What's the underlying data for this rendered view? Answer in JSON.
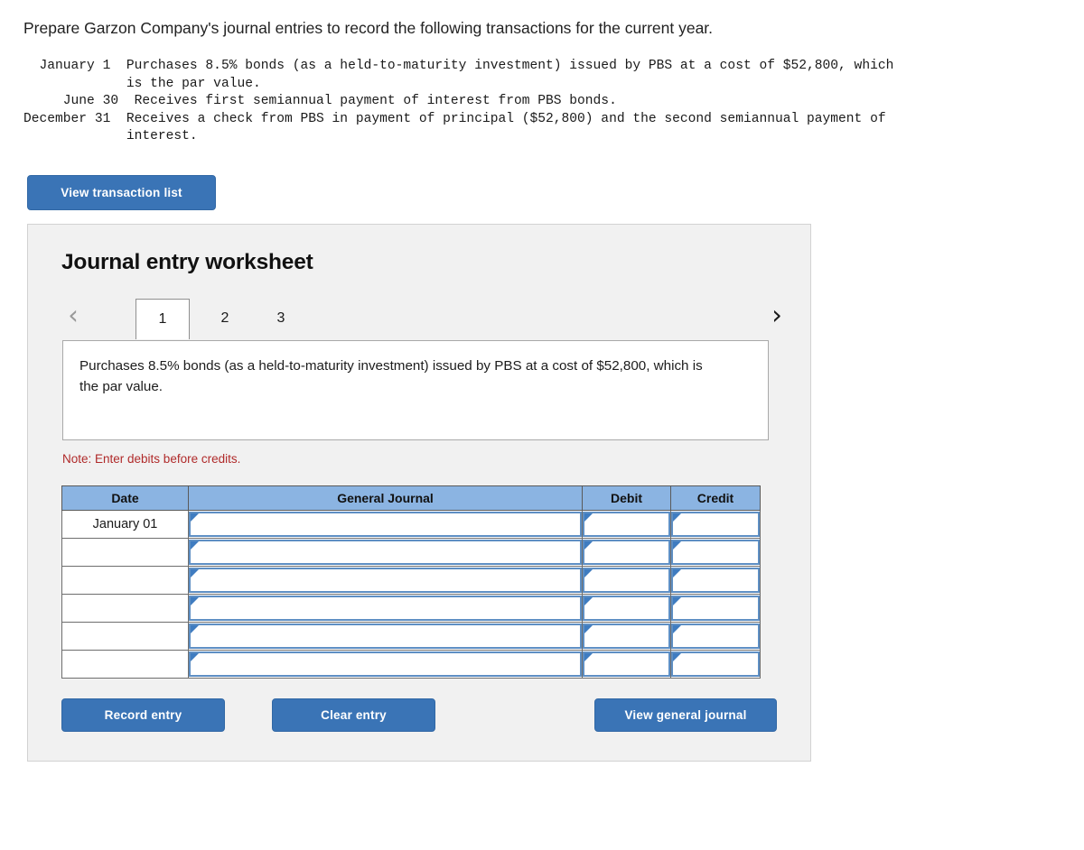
{
  "prompt": "Prepare Garzon Company's journal entries to record the following transactions for the current year.",
  "transactions_text": "  January 1  Purchases 8.5% bonds (as a held-to-maturity investment) issued by PBS at a cost of $52,800, which\n             is the par value.\n     June 30  Receives first semiannual payment of interest from PBS bonds.\nDecember 31  Receives a check from PBS in payment of principal ($52,800) and the second semiannual payment of\n             interest.",
  "buttons": {
    "view_transaction_list": "View transaction list",
    "record_entry": "Record entry",
    "clear_entry": "Clear entry",
    "view_general_journal": "View general journal"
  },
  "worksheet": {
    "title": "Journal entry worksheet",
    "prev_icon": "‹",
    "next_icon": "›",
    "tabs": [
      {
        "label": "1",
        "active": true
      },
      {
        "label": "2",
        "active": false
      },
      {
        "label": "3",
        "active": false
      }
    ],
    "description": "Purchases 8.5% bonds (as a held-to-maturity investment) issued by PBS at a cost of $52,800, which is the par value.",
    "note": "Note: Enter debits before credits.",
    "table": {
      "headers": [
        "Date",
        "General Journal",
        "Debit",
        "Credit"
      ],
      "rows": [
        {
          "date": "January 01",
          "general_journal": "",
          "debit": "",
          "credit": ""
        },
        {
          "date": "",
          "general_journal": "",
          "debit": "",
          "credit": ""
        },
        {
          "date": "",
          "general_journal": "",
          "debit": "",
          "credit": ""
        },
        {
          "date": "",
          "general_journal": "",
          "debit": "",
          "credit": ""
        },
        {
          "date": "",
          "general_journal": "",
          "debit": "",
          "credit": ""
        },
        {
          "date": "",
          "general_journal": "",
          "debit": "",
          "credit": ""
        }
      ]
    }
  },
  "colors": {
    "button_blue": "#3a74b6",
    "header_blue": "#8bb4e2",
    "note_red": "#b02a2a",
    "panel_bg": "#f1f1f1",
    "field_border_blue": "#5e8fc4"
  }
}
